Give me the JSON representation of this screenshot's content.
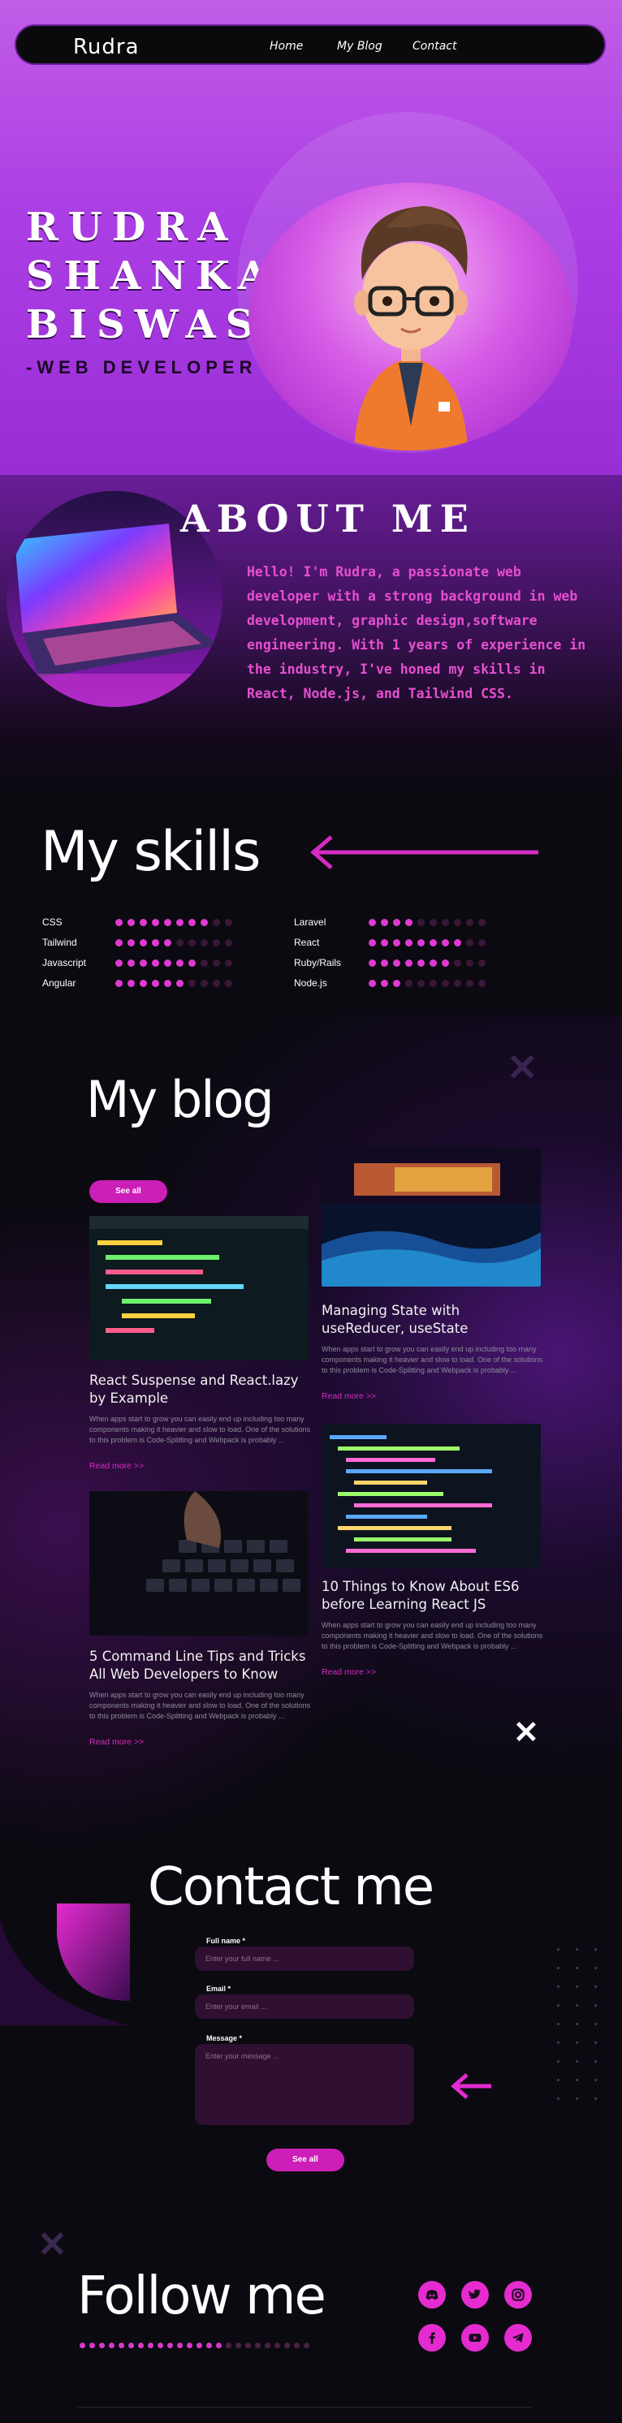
{
  "navbar": {
    "brand": "Rudra",
    "links": [
      "Home",
      "My Blog",
      "Contact"
    ]
  },
  "hero": {
    "name_lines": [
      "RUDRA",
      "SHANKAR",
      "BISWAS"
    ],
    "role": "-WEB DEVELOPER",
    "avatar_icon": "cartoon-avatar-icon"
  },
  "about": {
    "title": "ABOUT ME",
    "text": "Hello! I'm Rudra, a passionate web developer with a strong background in  web development, graphic design,software engineering. With 1 years of experience in the industry, I've honed my skills in React, Node.js, and Tailwind CSS.",
    "photo_icon": "laptop-photo"
  },
  "skills": {
    "title": "My skills",
    "left": [
      {
        "name": "CSS",
        "level": 8,
        "max": 10
      },
      {
        "name": "Tailwind",
        "level": 5,
        "max": 10
      },
      {
        "name": "Javascript",
        "level": 7,
        "max": 10
      },
      {
        "name": "Angular",
        "level": 6,
        "max": 10
      }
    ],
    "right": [
      {
        "name": "Laravel",
        "level": 4,
        "max": 10
      },
      {
        "name": "React",
        "level": 8,
        "max": 10
      },
      {
        "name": "Ruby/Rails",
        "level": 7,
        "max": 10
      },
      {
        "name": "Node.js",
        "level": 3,
        "max": 10
      }
    ]
  },
  "blog": {
    "title": "My blog",
    "see_all": "See all",
    "posts": [
      {
        "title": "React Suspense and React.lazy by Example",
        "excerpt": "When apps start to grow you can easily end up including too many components making it heavier and slow to load. One of the solutions to this problem is Code-Splitting and Webpack is probably ...",
        "read_more": "Read more >>",
        "image": "code-editor-photo"
      },
      {
        "title": "Managing State with useReducer, useState",
        "excerpt": "When apps start to grow you can easily end up including too many components making it heavier and slow to load. One of the solutions to this problem is Code-Splitting and Webpack is probably ...",
        "read_more": "Read more >>",
        "image": "data-wave-photo"
      },
      {
        "title": "5 Command Line Tips and Tricks All Web Developers to Know",
        "excerpt": "When apps start to grow you can easily end up including too many components making it heavier and slow to load. One of the solutions to this problem is Code-Splitting and Webpack is probably ...",
        "read_more": "Read more >>",
        "image": "keyboard-photo"
      },
      {
        "title": "10 Things to Know About ES6 before Learning React JS",
        "excerpt": "When apps start to grow you can easily end up including too many components making it heavier and slow to load. One of the solutions to this problem is Code-Splitting and Webpack is probably ...",
        "read_more": "Read more >>",
        "image": "code-screen-photo"
      }
    ]
  },
  "contact": {
    "title": "Contact me",
    "fields": [
      {
        "label": "Full name *",
        "placeholder": "Enter your full name ..."
      },
      {
        "label": "Email *",
        "placeholder": "Enter your email ..."
      },
      {
        "label": "Message *",
        "placeholder": "Enter your message ..."
      }
    ],
    "submit": "See all"
  },
  "follow": {
    "title": "Follow me",
    "socials": [
      "discord-icon",
      "twitter-icon",
      "instagram-icon",
      "facebook-icon",
      "youtube-icon",
      "telegram-icon"
    ]
  },
  "colors": {
    "accent": "#e03ad2",
    "hero_bg": "#ab3ee4",
    "page_bg": "#0b0a10"
  }
}
